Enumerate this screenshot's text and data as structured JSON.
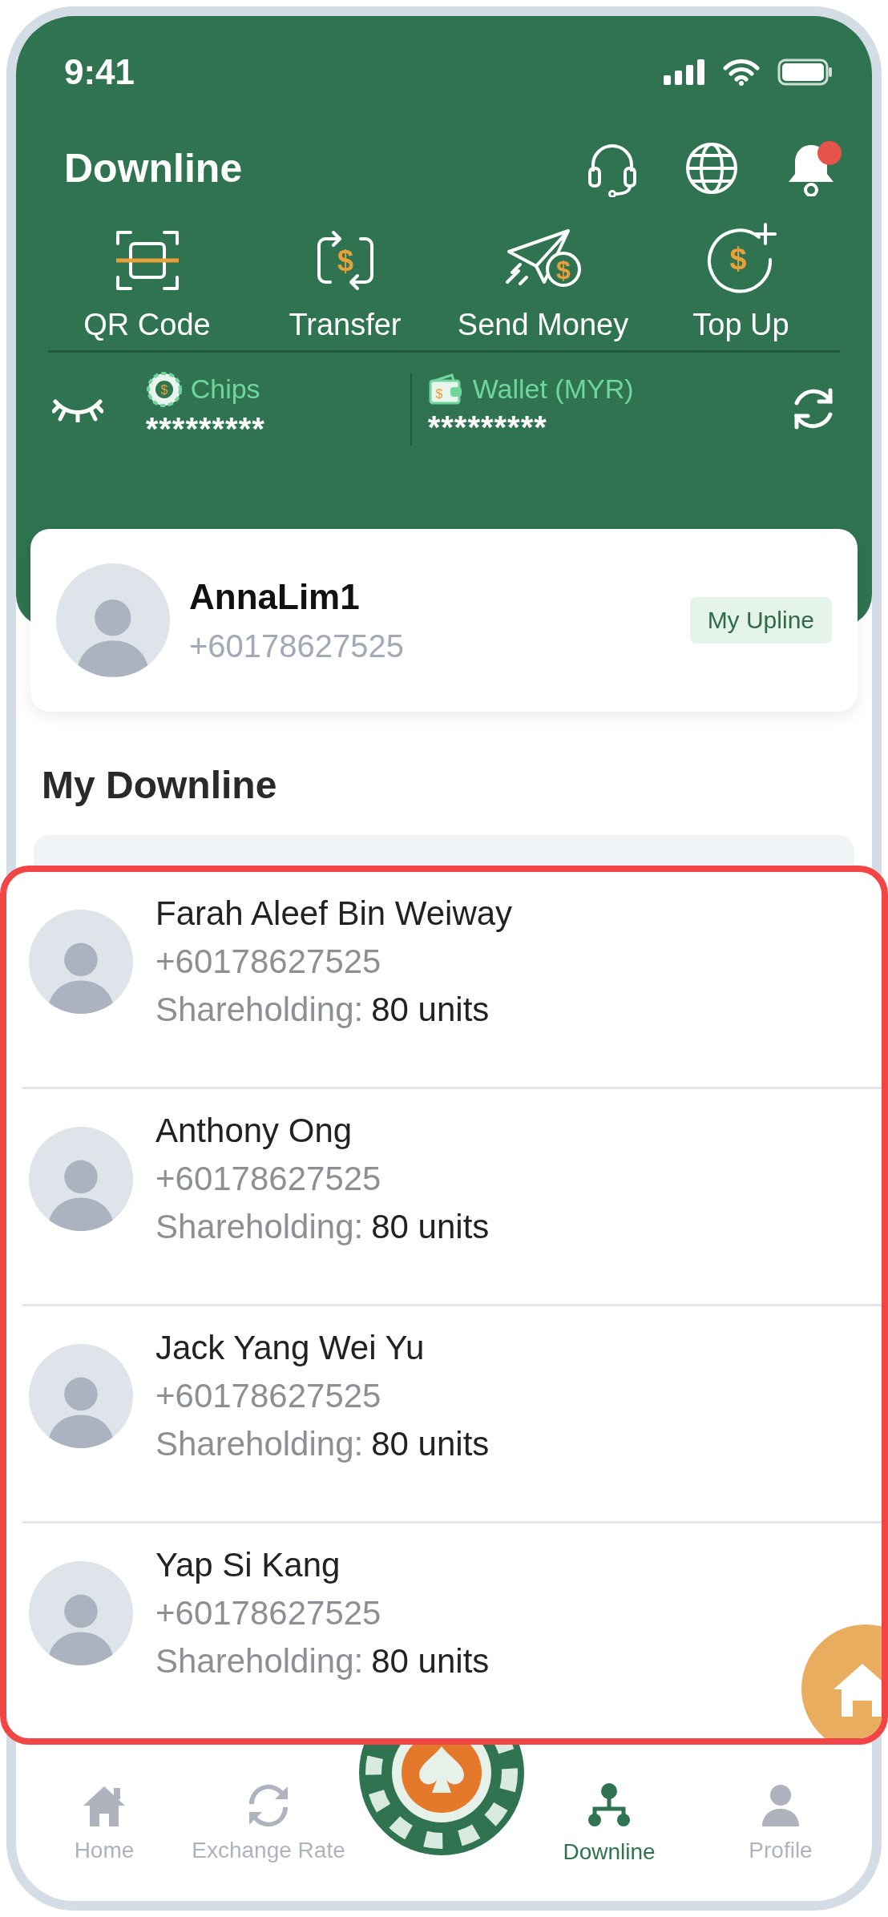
{
  "status_bar": {
    "time": "9:41"
  },
  "header": {
    "title": "Downline",
    "notification_dot": true
  },
  "actions": [
    {
      "kind": "qr",
      "label": "QR Code"
    },
    {
      "kind": "transfer",
      "label": "Transfer",
      "symbol": "$"
    },
    {
      "kind": "send",
      "label": "Send Money",
      "symbol": "$"
    },
    {
      "kind": "topup",
      "label": "Top Up",
      "symbol": "$"
    }
  ],
  "balances": [
    {
      "kind": "chips",
      "label": "Chips",
      "symbol": "$",
      "value": "*********"
    },
    {
      "kind": "wallet",
      "label": "Wallet (MYR)",
      "symbol": "$",
      "value": "*********"
    }
  ],
  "upline": {
    "name": "AnnaLim1",
    "phone": "+60178627525",
    "badge": "My Upline"
  },
  "section_title": "My Downline",
  "downline": [
    {
      "name": "Farah Aleef Bin Weiway",
      "phone": "+60178627525",
      "shareholding_label": "Shareholding:",
      "shareholding_value": "80 units"
    },
    {
      "name": "Anthony Ong",
      "phone": "+60178627525",
      "shareholding_label": "Shareholding:",
      "shareholding_value": "80 units"
    },
    {
      "name": "Jack Yang Wei Yu",
      "phone": "+60178627525",
      "shareholding_label": "Shareholding:",
      "shareholding_value": "80 units"
    },
    {
      "name": "Yap Si Kang",
      "phone": "+60178627525",
      "shareholding_label": "Shareholding:",
      "shareholding_value": "80 units"
    }
  ],
  "nav": [
    {
      "kind": "home",
      "label": "Home",
      "selected": false
    },
    {
      "kind": "exchange",
      "label": "Exchange Rate",
      "selected": false
    },
    {
      "kind": "chip"
    },
    {
      "kind": "downline",
      "label": "Downline",
      "selected": true
    },
    {
      "kind": "profile",
      "label": "Profile",
      "selected": false
    }
  ]
}
